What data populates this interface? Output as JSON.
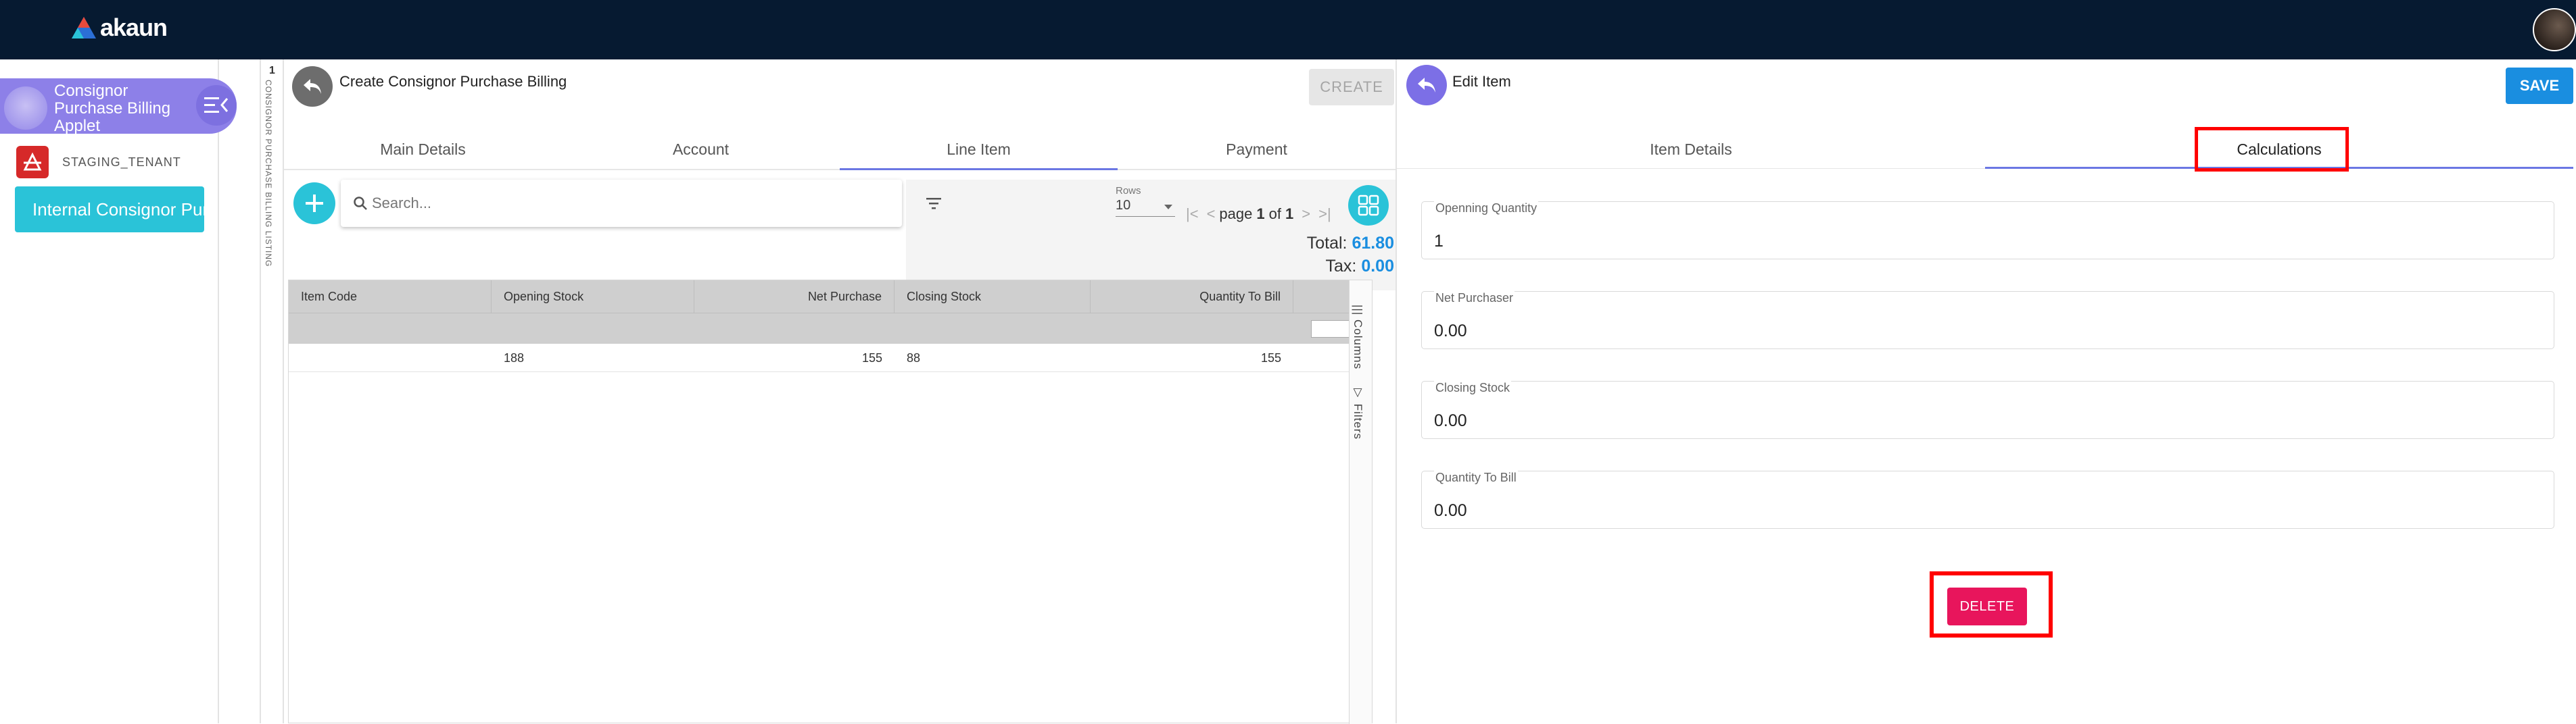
{
  "app": {
    "brand": "akaun"
  },
  "sidebar": {
    "applet_title": "Consignor Purchase Billing Applet",
    "tenant": "STAGING_TENANT",
    "active_item": "Internal Consignor Purchase Billing"
  },
  "listing_strip": {
    "number": "1",
    "label": "CONSIGNOR PURCHASE BILLING LISTING"
  },
  "main": {
    "title": "Create Consignor Purchase Billing",
    "create_label": "CREATE",
    "tabs": [
      "Main Details",
      "Account",
      "Line Item",
      "Payment"
    ],
    "active_tab": "Line Item",
    "search_placeholder": "Search...",
    "rows_label": "Rows",
    "rows_value": "10",
    "page_word": "page",
    "page_current": "1",
    "page_of": "of",
    "page_total": "1",
    "total_label": "Total:",
    "total_value": "61.80",
    "tax_label": "Tax:",
    "tax_value": "0.00",
    "table": {
      "columns": [
        "Item Code",
        "Opening Stock",
        "Net Purchase",
        "Closing Stock",
        "Quantity To Bill"
      ],
      "rows": [
        {
          "item_code": "",
          "opening_stock": "188",
          "net_purchase": "155",
          "closing_stock": "88",
          "quantity_to_bill": "155"
        }
      ]
    },
    "side_tabs": {
      "columns": "Columns",
      "filters": "Filters"
    }
  },
  "edit_panel": {
    "title": "Edit Item",
    "save_label": "SAVE",
    "tabs": [
      "Item Details",
      "Calculations"
    ],
    "active_tab": "Calculations",
    "fields": [
      {
        "label": "Openning Quantity",
        "value": "1"
      },
      {
        "label": "Net Purchaser",
        "value": "0.00"
      },
      {
        "label": "Closing Stock",
        "value": "0.00"
      },
      {
        "label": "Quantity To Bill",
        "value": "0.00"
      }
    ],
    "delete_label": "DELETE"
  },
  "colors": {
    "topbar": "#061a31",
    "accent_cyan": "#2ac3d8",
    "accent_blue": "#1a8ee0",
    "applet_purple": "#8d80e8",
    "delete_pink": "#e8155c",
    "highlight_red": "#ff0000"
  },
  "icons": [
    "akaun-logo-icon",
    "menu-collapse-icon",
    "tenant-icon",
    "back-arrow-icon",
    "plus-icon",
    "search-icon",
    "filter-icon",
    "grid-view-icon",
    "columns-icon",
    "filter-funnel-icon",
    "avatar"
  ]
}
